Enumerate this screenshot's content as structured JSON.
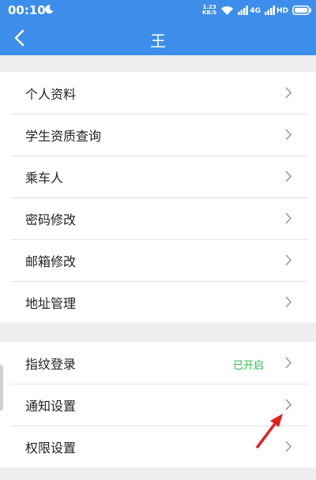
{
  "status_bar": {
    "time": "00:10",
    "net_speed_value": "1.23",
    "net_speed_unit": "KB/S",
    "signal1_label": "4G",
    "signal2_label": "HD"
  },
  "header": {
    "title": "王"
  },
  "group1": [
    {
      "label": "个人资料"
    },
    {
      "label": "学生资质查询"
    },
    {
      "label": "乘车人"
    },
    {
      "label": "密码修改"
    },
    {
      "label": "邮箱修改"
    },
    {
      "label": "地址管理"
    }
  ],
  "group2": [
    {
      "label": "指纹登录",
      "status": "已开启"
    },
    {
      "label": "通知设置"
    },
    {
      "label": "权限设置"
    }
  ],
  "colors": {
    "brand": "#3d8eea",
    "enabled_status": "#2db84a",
    "annotation_arrow": "#e02020"
  },
  "icons": [
    "moon-icon",
    "wifi-icon",
    "signal-icon",
    "battery-icon",
    "back-arrow-icon",
    "chevron-right-icon",
    "pointer-arrow-icon"
  ]
}
